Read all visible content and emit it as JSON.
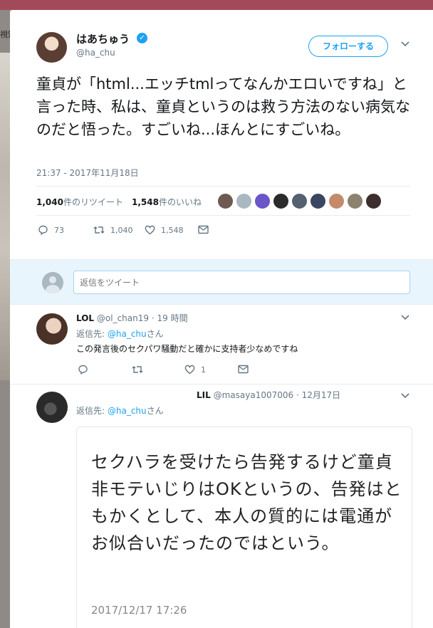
{
  "background": {
    "left_text": "視知"
  },
  "tweet": {
    "author_name": "はあちゅう",
    "handle": "@ha_chu",
    "verified_glyph": "✓",
    "follow_label": "フォローする",
    "text": "童貞が「html...エッチtmlってなんかエロいですね」と言った時、私は、童貞というのは救う方法のない病気なのだと悟った。すごいね...ほんとにすごいね。",
    "timestamp": "21:37 - 2017年11月18日",
    "retweets_count": "1,040",
    "retweets_label": "件のリツイート",
    "likes_count": "1,548",
    "likes_label": "件のいいね",
    "actions": {
      "reply_count": "73",
      "retweet_count": "1,040",
      "like_count": "1,548"
    }
  },
  "reply_box": {
    "placeholder": "返信をツイート"
  },
  "replies": [
    {
      "name": "LOL",
      "handle": "@ol_chan19",
      "time": "19 時間",
      "to_prefix": "返信先: ",
      "to_handle": "@ha_chu",
      "to_suffix": "さん",
      "text": "この発言後のセクパワ騒動だと確かに支持者少なめですね",
      "like_count": "1"
    },
    {
      "name": "LIL",
      "handle": "@masaya1007006",
      "time": "12月17日",
      "to_prefix": "返信先: ",
      "to_handle": "@ha_chu",
      "to_suffix": "さん",
      "quote_text": "セクハラを受けたら告発するけど童貞非モテいじりはOKというの、告発はともかくとして、本人の質的には電通がお似合いだったのではという。",
      "quote_date": "2017/12/17 17:26"
    }
  ],
  "colors": {
    "accent": "#1da1f2",
    "muted": "#657786",
    "reply_bg": "#e8f5fd"
  }
}
